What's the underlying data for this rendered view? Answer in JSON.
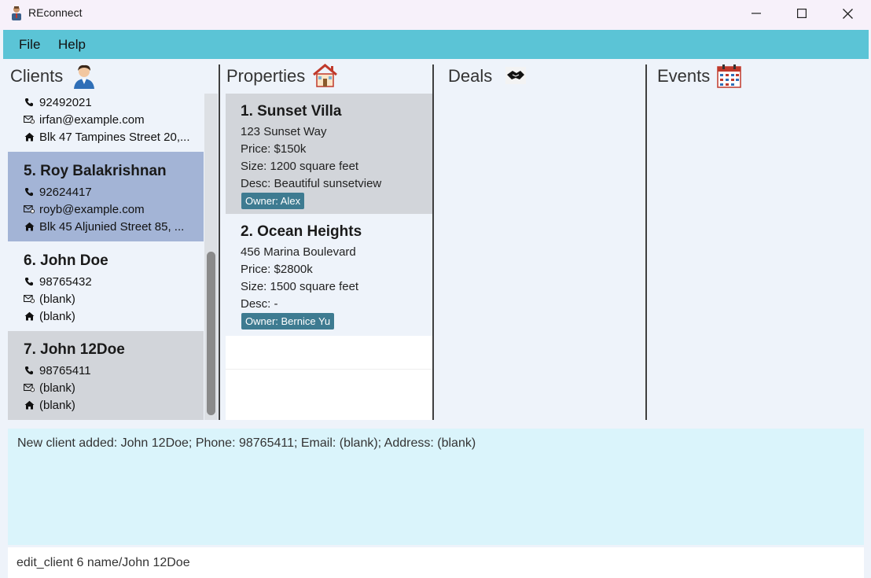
{
  "window": {
    "title": "REconnect"
  },
  "menu": {
    "file": "File",
    "help": "Help"
  },
  "panels": {
    "clients": "Clients",
    "properties": "Properties",
    "deals": "Deals",
    "events": "Events"
  },
  "clients": [
    {
      "name": "",
      "phone": "92492021",
      "email": "irfan@example.com",
      "address": "Blk 47 Tampines Street 20,..."
    },
    {
      "name": "5. Roy Balakrishnan",
      "phone": "92624417",
      "email": "royb@example.com",
      "address": "Blk 45 Aljunied Street 85, ..."
    },
    {
      "name": "6. John Doe",
      "phone": "98765432",
      "email": "(blank)",
      "address": "(blank)"
    },
    {
      "name": "7. John 12Doe",
      "phone": "98765411",
      "email": "(blank)",
      "address": "(blank)"
    }
  ],
  "properties": [
    {
      "title": "1. Sunset Villa",
      "address": "123 Sunset Way",
      "price": "Price: $150k",
      "size": "Size: 1200 square feet",
      "desc": "Desc: Beautiful sunsetview",
      "owner": "Owner: Alex"
    },
    {
      "title": "2. Ocean Heights",
      "address": "456 Marina Boulevard",
      "price": "Price: $2800k",
      "size": "Size: 1500 square feet",
      "desc": "Desc: -",
      "owner": "Owner: Bernice Yu"
    }
  ],
  "result": {
    "text": "New client added: John 12Doe; Phone: 98765411; Email: (blank); Address: (blank)"
  },
  "command": {
    "value": "edit_client 6 name/John 12Doe"
  },
  "colors": {
    "menu_bar": "#5bc4d6",
    "selected_card": "#a3b4d6",
    "owner_tag": "#3e7b91",
    "result_bg": "#daf4fb"
  }
}
